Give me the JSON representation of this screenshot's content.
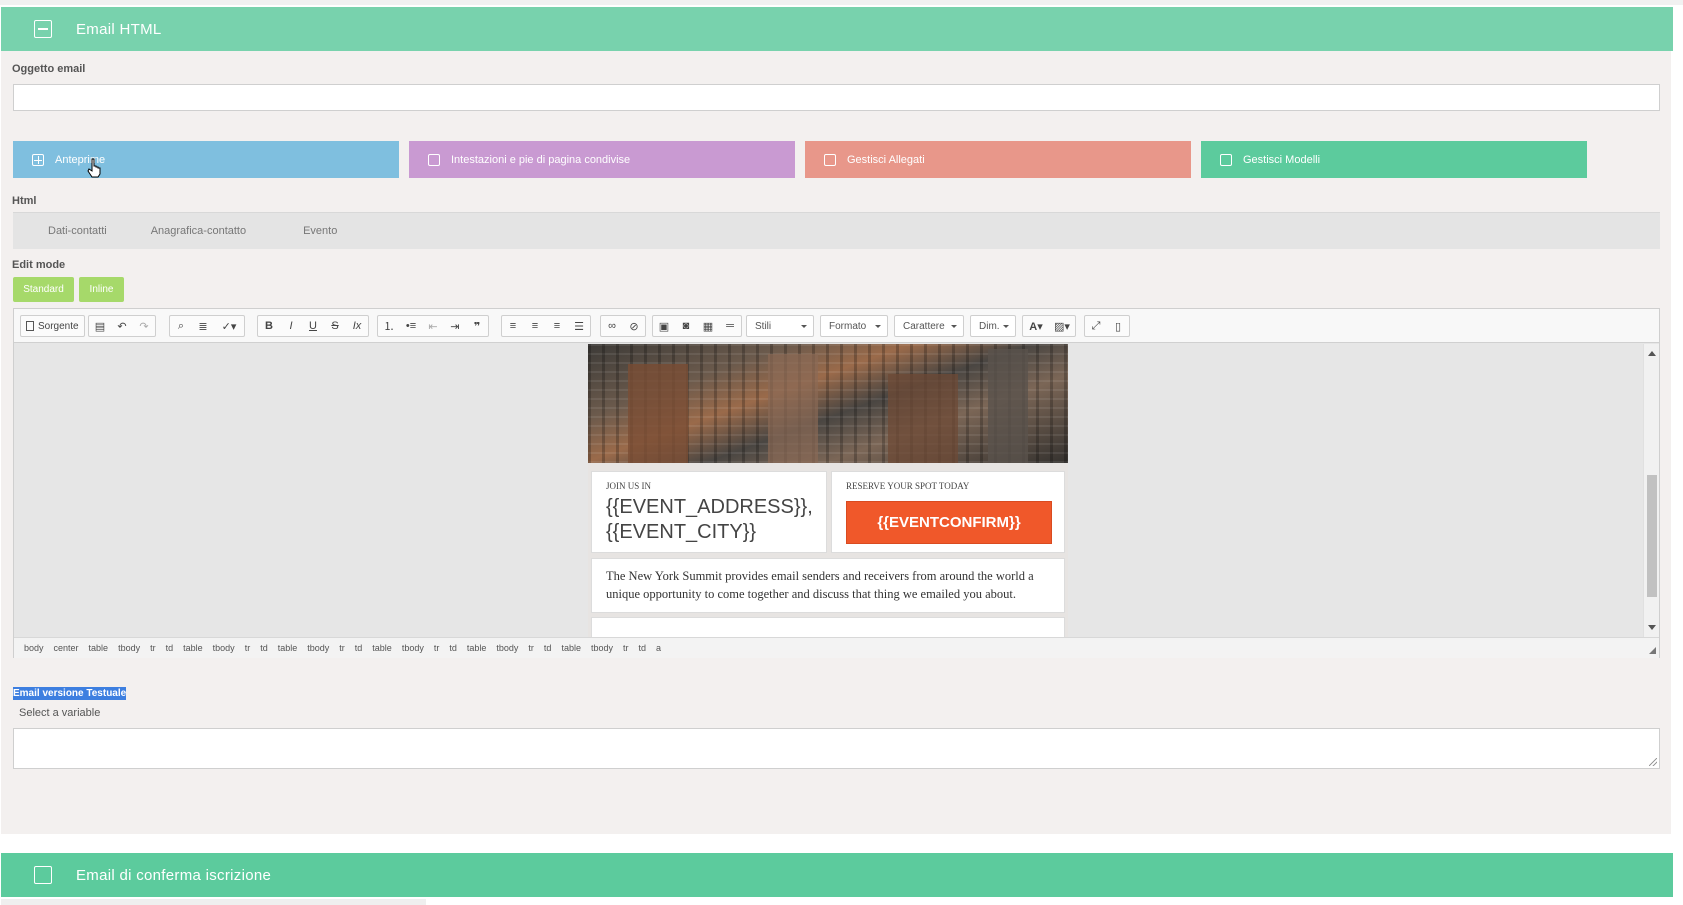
{
  "sections": {
    "html_email": {
      "title": "Email HTML"
    },
    "confirm_email": {
      "title": "Email di conferma iscrizione"
    }
  },
  "subject": {
    "label": "Oggetto email",
    "value": "",
    "placeholder": ""
  },
  "tiles": [
    {
      "label": "Anteprime",
      "color": "#7fbfdf"
    },
    {
      "label": "Intestazioni e pie di pagina condivise",
      "color": "#c99ad2"
    },
    {
      "label": "Gestisci Allegati",
      "color": "#e8978a"
    },
    {
      "label": "Gestisci Modelli",
      "color": "#5ccb9d"
    }
  ],
  "html_label": "Html",
  "variable_tabs": [
    "Dati-contatti",
    "Anagrafica-contatto",
    "Evento"
  ],
  "edit_mode": {
    "label": "Edit mode",
    "buttons": [
      "Standard",
      "Inline"
    ]
  },
  "toolbar": {
    "source_label": "Sorgente",
    "combos": [
      "Stili",
      "Formato",
      "Carattere",
      "Dim."
    ]
  },
  "email_preview": {
    "join_caption": "JOIN US IN",
    "address_line1": "{{EVENT_ADDRESS}},",
    "address_line2": "{{EVENT_CITY}}",
    "reserve_caption": "RESERVE YOUR SPOT TODAY",
    "cta_label": "{{EVENTCONFIRM}}",
    "body_text": "The New York Summit provides email senders and receivers from around the world a unique opportunity to come together and discuss that thing we emailed you about.",
    "cta_color": "#f0582a"
  },
  "element_path": [
    "body",
    "center",
    "table",
    "tbody",
    "tr",
    "td",
    "table",
    "tbody",
    "tr",
    "td",
    "table",
    "tbody",
    "tr",
    "td",
    "table",
    "tbody",
    "tr",
    "td",
    "table",
    "tbody",
    "tr",
    "td",
    "table",
    "tbody",
    "tr",
    "td",
    "a"
  ],
  "text_version": {
    "label": "Email versione Testuale",
    "hint": "Select a variable",
    "value": ""
  },
  "colors": {
    "header_top": "#78d2ad",
    "header_bottom": "#5ccb9d",
    "mode_buttons": "#a6d96a"
  }
}
